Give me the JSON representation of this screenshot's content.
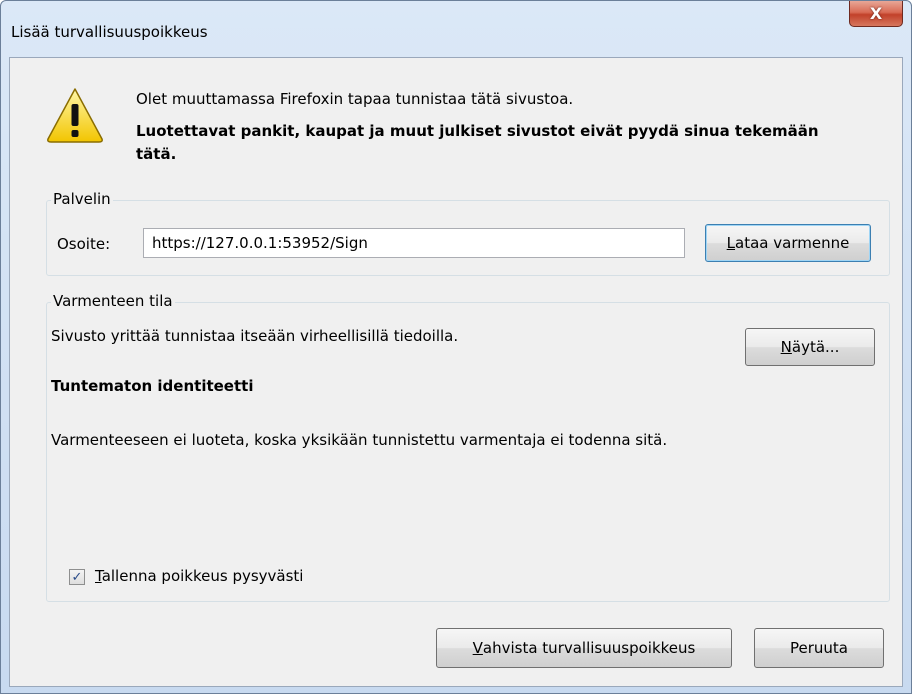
{
  "window": {
    "title": "Lisää turvallisuuspoikkeus",
    "close_label": "X"
  },
  "warning": {
    "icon": "warning-triangle-icon",
    "intro": "Olet muuttamassa Firefoxin tapaa tunnistaa tätä sivustoa.",
    "bold_text": "Luotettavat pankit, kaupat ja muut julkiset sivustot eivät pyydä sinua tekemään tätä."
  },
  "server": {
    "legend": "Palvelin",
    "address_label": "Osoite:",
    "address_value": "https://127.0.0.1:53952/Sign",
    "load_button_mnemonic": "L",
    "load_button_rest": "ataa varmenne"
  },
  "status": {
    "legend": "Varmenteen tila",
    "description": "Sivusto yrittää tunnistaa itseään virheellisillä tiedoilla.",
    "view_button_mnemonic": "N",
    "view_button_rest": "äytä...",
    "unknown_identity": "Tuntematon identiteetti",
    "untrusted_text": "Varmenteeseen ei luoteta, koska yksikään tunnistettu varmentaja ei todenna sitä.",
    "permanent_checked": true,
    "permanent_mnemonic": "T",
    "permanent_rest": "allenna poikkeus pysyvästi"
  },
  "buttons": {
    "confirm_mnemonic": "V",
    "confirm_rest": "ahvista turvallisuuspoikkeus",
    "cancel": "Peruuta"
  }
}
